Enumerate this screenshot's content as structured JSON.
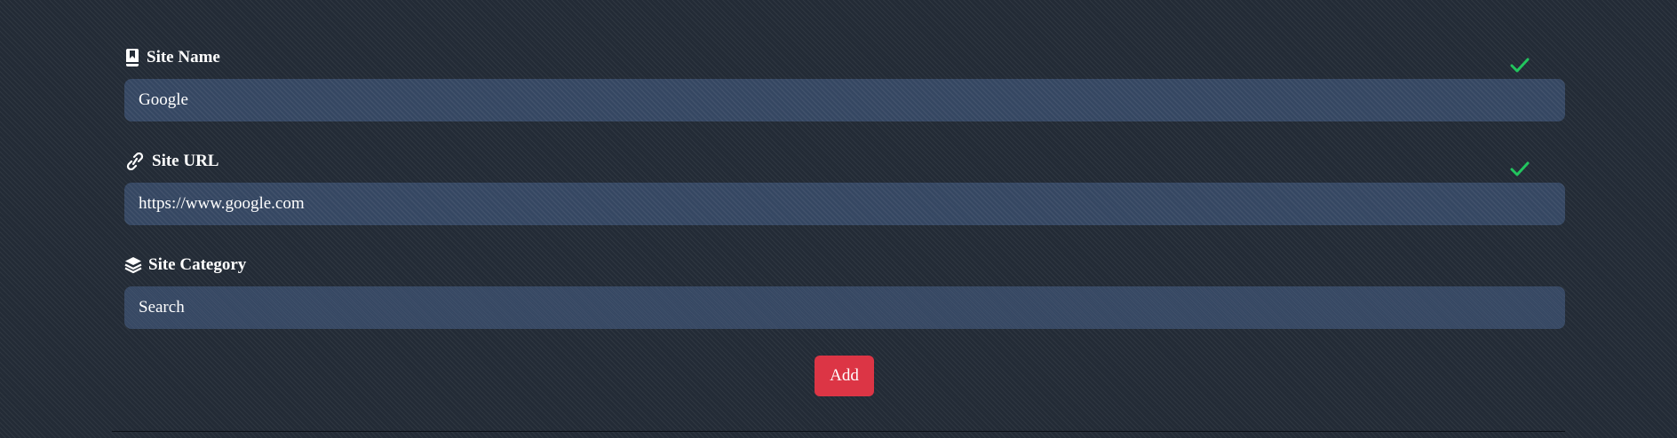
{
  "form": {
    "site_name": {
      "label": "Site Name",
      "icon": "bookmark-icon",
      "value": "Google",
      "valid": true
    },
    "site_url": {
      "label": "Site URL",
      "icon": "link-icon",
      "value": "https://www.google.com",
      "valid": true
    },
    "site_category": {
      "label": "Site Category",
      "icon": "layers-icon",
      "value": "Search"
    },
    "add_label": "Add"
  },
  "colors": {
    "valid_check": "#22c55e",
    "add_button": "#dc3545"
  }
}
